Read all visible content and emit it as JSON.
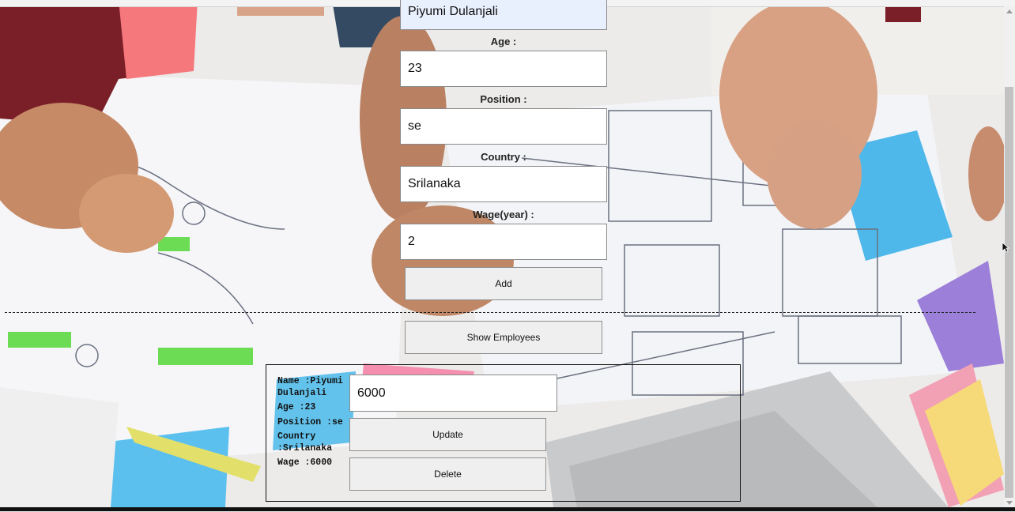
{
  "form": {
    "name_value": "Piyumi Dulanjali",
    "age_label": "Age :",
    "age_value": "23",
    "position_label": "Position :",
    "position_value": "se",
    "country_label": "Country :",
    "country_value": "Srilanaka",
    "wage_label": "Wage(year) :",
    "wage_value": "2",
    "add_label": "Add"
  },
  "show_employees_label": "Show Employees",
  "employee_card": {
    "name_line": "Name :Piyumi Dulanjali",
    "age_line": "Age :23",
    "position_line": "Position :se",
    "country_line": "Country :Srilanaka",
    "wage_line": "Wage :6000",
    "new_wage_value": "6000",
    "update_label": "Update",
    "delete_label": "Delete"
  }
}
